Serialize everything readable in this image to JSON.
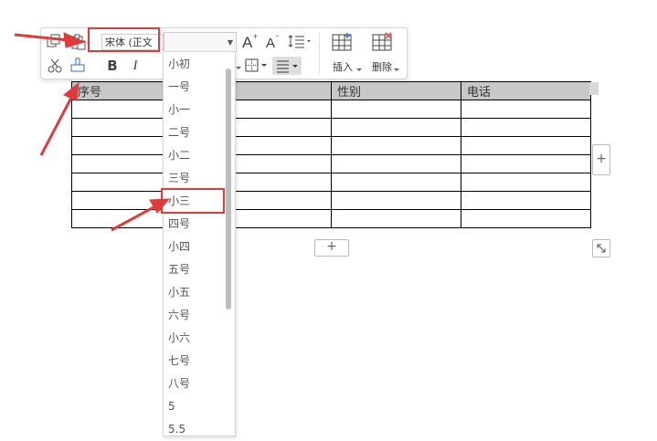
{
  "toolbar": {
    "font_name": "宋体 (正文",
    "insert_label": "插入",
    "delete_label": "删除",
    "bold": "B",
    "italic": "I"
  },
  "table": {
    "headers": [
      "序号",
      "",
      "性别",
      "电话"
    ],
    "empty_rows": 7
  },
  "font_size_dropdown": {
    "items": [
      "小初",
      "一号",
      "小一",
      "二号",
      "小二",
      "三号",
      "小三",
      "四号",
      "小四",
      "五号",
      "小五",
      "六号",
      "小六",
      "七号",
      "八号",
      "5",
      "5.5"
    ],
    "highlighted": "小三"
  },
  "colors": {
    "annotation_red": "#e03a3a",
    "header_fill": "#c8c8c8"
  }
}
